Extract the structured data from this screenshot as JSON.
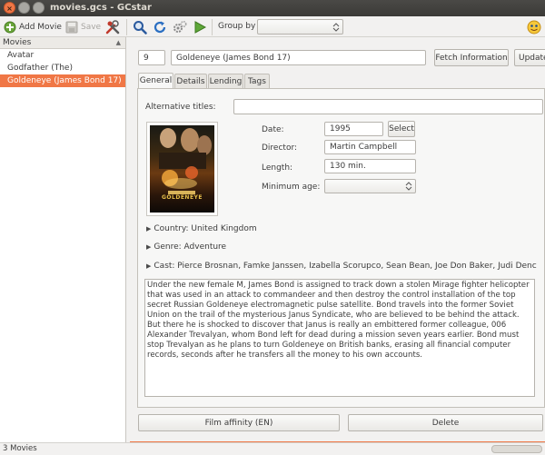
{
  "window": {
    "title": "movies.gcs - GCstar",
    "close_glyph": "×"
  },
  "toolbar": {
    "add_movie": "Add Movie",
    "save": "Save",
    "group_by_label": "Group by",
    "group_by_value": ""
  },
  "sidebar": {
    "header": "Movies",
    "items": [
      {
        "label": "Avatar"
      },
      {
        "label": "Godfather (The)"
      },
      {
        "label": "Goldeneye (James Bond 17)"
      }
    ],
    "selected_index": 2
  },
  "movie": {
    "id": "9",
    "title": "Goldeneye (James Bond 17)",
    "fetch_button": "Fetch Information",
    "update_button": "Update"
  },
  "tabs": [
    {
      "label": "General"
    },
    {
      "label": "Details"
    },
    {
      "label": "Lending"
    },
    {
      "label": "Tags"
    }
  ],
  "general": {
    "alt_titles_label": "Alternative titles:",
    "alt_titles_value": "",
    "date_label": "Date:",
    "date_value": "1995",
    "select_button": "Select",
    "director_label": "Director:",
    "director_value": "Martin Campbell",
    "length_label": "Length:",
    "length_value": "130 min.",
    "min_age_label": "Minimum age:",
    "min_age_value": "",
    "country": "Country: United Kingdom",
    "genre": "Genre: Adventure",
    "cast": "Cast: Pierce Brosnan, Famke Janssen, Izabella Scorupco, Sean Bean, Joe Don Baker, Judi Dench, T...",
    "description": "Under the new female M, James Bond is assigned to track down a stolen Mirage fighter helicopter that was used in an attack to commandeer and then destroy the control installation of the top secret Russian Goldeneye electromagnetic pulse satellite. Bond travels into the former Soviet Union on the trail of the mysterious Janus Syndicate, who are believed to be behind the attack. But there he is shocked to discover that Janus is really an embittered former colleague, 006 Alexander Trevalyan, whom Bond left for dead during a mission seven years earlier. Bond must stop Trevalyan as he plans to turn Goldeneye on British banks, erasing all financial computer records, seconds after he transfers all the money to his own accounts.",
    "poster_text": "GOLDENEYE"
  },
  "actions": {
    "film_affinity": "Film affinity (EN)",
    "delete": "Delete"
  },
  "status": {
    "count": "3 Movies"
  },
  "colors": {
    "accent": "#f07746",
    "titlebar": "#3b3a37"
  }
}
